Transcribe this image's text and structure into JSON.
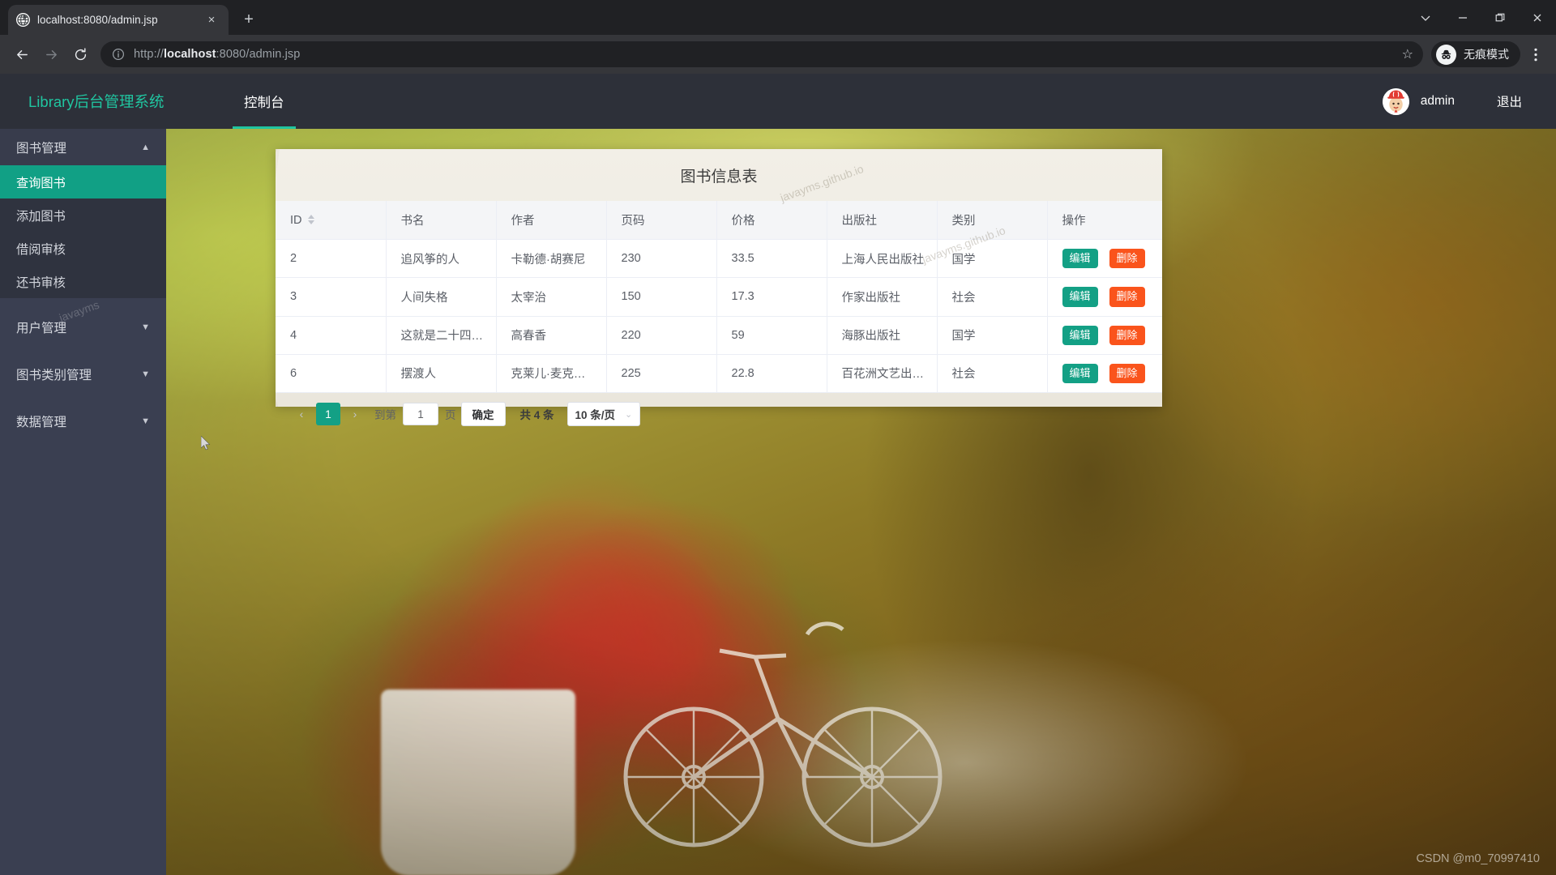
{
  "browser": {
    "tab": {
      "title": "localhost:8080/admin.jsp",
      "favicon": "globe-icon",
      "close": "×"
    },
    "newtab_label": "+",
    "window": {
      "minimize": "−",
      "maximize": "❐",
      "close": "✕",
      "chevron": "⌄"
    },
    "toolbar": {
      "back": "←",
      "forward": "→",
      "reload": "⟳",
      "url_scheme": "http://",
      "url_host_bold": "localhost",
      "url_rest": ":8080/admin.jsp",
      "url_full": "http://localhost:8080/admin.jsp",
      "bookmark": "☆",
      "incognito_label": "无痕模式",
      "menu": "⋮"
    }
  },
  "app": {
    "brand": "Library后台管理系统",
    "nav_tabs": [
      {
        "label": "控制台",
        "active": true
      }
    ],
    "user": {
      "name": "admin",
      "logout": "退出"
    }
  },
  "sidebar": {
    "groups": [
      {
        "label": "图书管理",
        "caret": "▲",
        "expanded": true,
        "items": [
          {
            "label": "查询图书",
            "active": true
          },
          {
            "label": "添加图书",
            "active": false
          },
          {
            "label": "借阅审核",
            "active": false
          },
          {
            "label": "还书审核",
            "active": false
          }
        ]
      },
      {
        "label": "用户管理",
        "caret": "▼",
        "expanded": false,
        "items": []
      },
      {
        "label": "图书类别管理",
        "caret": "▼",
        "expanded": false,
        "items": []
      },
      {
        "label": "数据管理",
        "caret": "▼",
        "expanded": false,
        "items": []
      }
    ]
  },
  "card": {
    "title": "图书信息表",
    "table": {
      "columns": [
        {
          "key": "id",
          "label": "ID",
          "sortable": true
        },
        {
          "key": "title",
          "label": "书名",
          "sortable": false
        },
        {
          "key": "author",
          "label": "作者",
          "sortable": false
        },
        {
          "key": "pages",
          "label": "页码",
          "sortable": false
        },
        {
          "key": "price",
          "label": "价格",
          "sortable": false
        },
        {
          "key": "publisher",
          "label": "出版社",
          "sortable": false
        },
        {
          "key": "category",
          "label": "类别",
          "sortable": false
        },
        {
          "key": "actions",
          "label": "操作",
          "sortable": false
        }
      ],
      "rows": [
        {
          "id": "2",
          "title": "追风筝的人",
          "author": "卡勒德·胡赛尼",
          "pages": "230",
          "price": "33.5",
          "publisher": "上海人民出版社",
          "category": "国学"
        },
        {
          "id": "3",
          "title": "人间失格",
          "author": "太宰治",
          "pages": "150",
          "price": "17.3",
          "publisher": "作家出版社",
          "category": "社会"
        },
        {
          "id": "4",
          "title": "这就是二十四…",
          "author": "高春香",
          "pages": "220",
          "price": "59",
          "publisher": "海豚出版社",
          "category": "国学"
        },
        {
          "id": "6",
          "title": "摆渡人",
          "author": "克莱儿·麦克…",
          "pages": "225",
          "price": "22.8",
          "publisher": "百花洲文艺出…",
          "category": "社会"
        }
      ],
      "row_actions": {
        "edit": "编辑",
        "delete": "删除"
      }
    },
    "pagination": {
      "prev": "‹",
      "next": "›",
      "current_page": "1",
      "goto_prefix": "到第",
      "goto_value": "1",
      "goto_suffix": "页",
      "confirm": "确定",
      "total": "共 4 条",
      "page_size": "10 条/页",
      "chevron": "⌄"
    }
  },
  "watermarks": {
    "site_marks": [
      "javayms",
      "javayms.github.io",
      "javayms.github.io"
    ],
    "csdn": "CSDN @m0_70997410"
  },
  "colors": {
    "brand_teal": "#20c5a0",
    "accent_teal": "#13a085",
    "danger_orange": "#fa541c",
    "sidebar_bg": "#3a3f51",
    "sidebar_sub_bg": "#2f333f",
    "header_bg": "#2d3039"
  }
}
